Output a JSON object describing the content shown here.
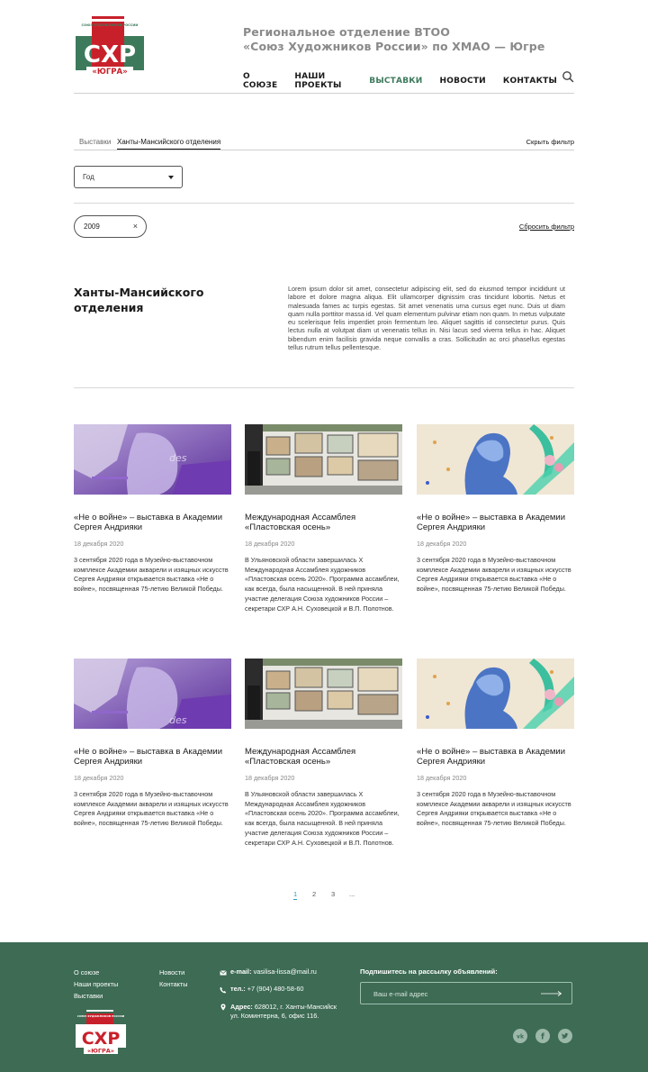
{
  "header": {
    "logo": {
      "top_text": "СОЮЗ ХУДОЖНИКОВ РОССИИ",
      "main": "СХР",
      "sub": "«ЮГРА»"
    },
    "org_line1": "Региональное отделение ВТОО",
    "org_line2": "«Союз Художников России» по ХМАО — Югре",
    "nav": [
      "О СОЮЗЕ",
      "НАШИ ПРОЕКТЫ",
      "ВЫСТАВКИ",
      "НОВОСТИ",
      "КОНТАКТЫ"
    ],
    "nav_active_index": 2,
    "search_icon": "search-icon"
  },
  "filter": {
    "tab_1": "Выставки",
    "tab_2": "Ханты-Мансийского отделения",
    "hide": "Скрыть фильтр",
    "select_value": "Год",
    "chip": "2009",
    "chip_close": "×",
    "reset": "Сбросить фильтр"
  },
  "section": {
    "title_line1": "Ханты-Мансийского",
    "title_line2": "отделения",
    "description": "Lorem ipsum dolor sit amet, consectetur adipiscing elit, sed do eiusmod tempor incididunt ut labore et dolore magna aliqua. Elit ullamcorper dignissim cras tincidunt lobortis. Netus et malesuada fames ac turpis egestas. Sit amet venenatis urna cursus eget nunc. Duis ut diam quam nulla porttitor massa id. Vel quam elementum pulvinar etiam non quam. In metus vulputate eu scelerisque felis imperdiet proin fermentum leo. Aliquet sagittis id consectetur purus. Quis lectus nulla at volutpat diam ut venenatis tellus in. Nisi lacus sed viverra tellus in hac. Aliquet bibendum enim facilisis gravida neque convallis a cras. Sollicitudin ac orci phasellus egestas tellus rutrum tellus pellentesque."
  },
  "cards": [
    {
      "image": "exhibition-photo-purple",
      "title": "«Не о войне» – выставка в Академии Сергея Андрияки",
      "date": "18 декабря 2020",
      "text": "3 сентября 2020 года в Музейно-выставочном комплексе Академии акварели и изящных искусств Сергея Андрияки открывается выставка «Не о войне», посвященная 75-летию Великой Победы."
    },
    {
      "image": "exhibition-photo-market",
      "title": "Международная Ассамблея «Пластовская осень»",
      "date": "18 декабря 2020",
      "text": "В Ульяновской области завершилась X Международная Ассамблея художников «Пластовская осень 2020». Программа ассамблеи, как всегда, была насыщенной. В ней приняла участие делегация Союза художников России – секретари СХР А.Н. Суховецкой и В.П. Полотнов."
    },
    {
      "image": "exhibition-photo-statue",
      "title": "«Не о войне» – выставка в Академии Сергея Андрияки",
      "date": "18 декабря 2020",
      "text": "3 сентября 2020 года в Музейно-выставочном комплексе Академии акварели и изящных искусств Сергея Андрияки открывается выставка «Не о войне», посвященная 75-летию Великой Победы."
    },
    {
      "image": "exhibition-photo-purple",
      "title": "«Не о войне» – выставка в Академии Сергея Андрияки",
      "date": "18 декабря 2020",
      "text": "3 сентября 2020 года в Музейно-выставочном комплексе Академии акварели и изящных искусств Сергея Андрияки открывается выставка «Не о войне», посвященная 75-летию Великой Победы."
    },
    {
      "image": "exhibition-photo-market",
      "title": "Международная Ассамблея «Пластовская осень»",
      "date": "18 декабря 2020",
      "text": "В Ульяновской области завершилась X Международная Ассамблея художников «Пластовская осень 2020». Программа ассамблеи, как всегда, была насыщенной. В ней приняла участие делегация Союза художников России – секретари СХР А.Н. Суховецкой и В.П. Полотнов."
    },
    {
      "image": "exhibition-photo-statue",
      "title": "«Не о войне» – выставка в Академии Сергея Андрияки",
      "date": "18 декабря 2020",
      "text": "3 сентября 2020 года в Музейно-выставочном комплексе Академии акварели и изящных искусств Сергея Андрияки открывается выставка «Не о войне», посвященная 75-летию Великой Победы."
    }
  ],
  "pagination": {
    "pages": [
      "1",
      "2",
      "3",
      "..."
    ],
    "active": "1"
  },
  "footer": {
    "links_col1": [
      "О союзе",
      "Наши проекты",
      "Выставки"
    ],
    "links_col2": [
      "Новости",
      "Контакты"
    ],
    "email_label": "e-mail:",
    "email": "vasilisa-lissa@mail.ru",
    "phone_label": "тел.:",
    "phone": "+7 (904) 480-58-60",
    "address_label": "Адрес:",
    "address_line1": "628012, г. Ханты-Мансийск",
    "address_line2": "ул. Коминтерна, 6, офис 116.",
    "subscribe_label": "Подпишитесь на рассылку объявлений:",
    "subscribe_placeholder": "Ваш e-mail адрес",
    "socials": [
      "vk-icon",
      "facebook-icon",
      "twitter-icon"
    ]
  },
  "colors": {
    "brand_green": "#3d6b54",
    "accent_green": "#3d7a5c",
    "brand_red": "#c8202b",
    "link_blue": "#2a9dbd"
  }
}
